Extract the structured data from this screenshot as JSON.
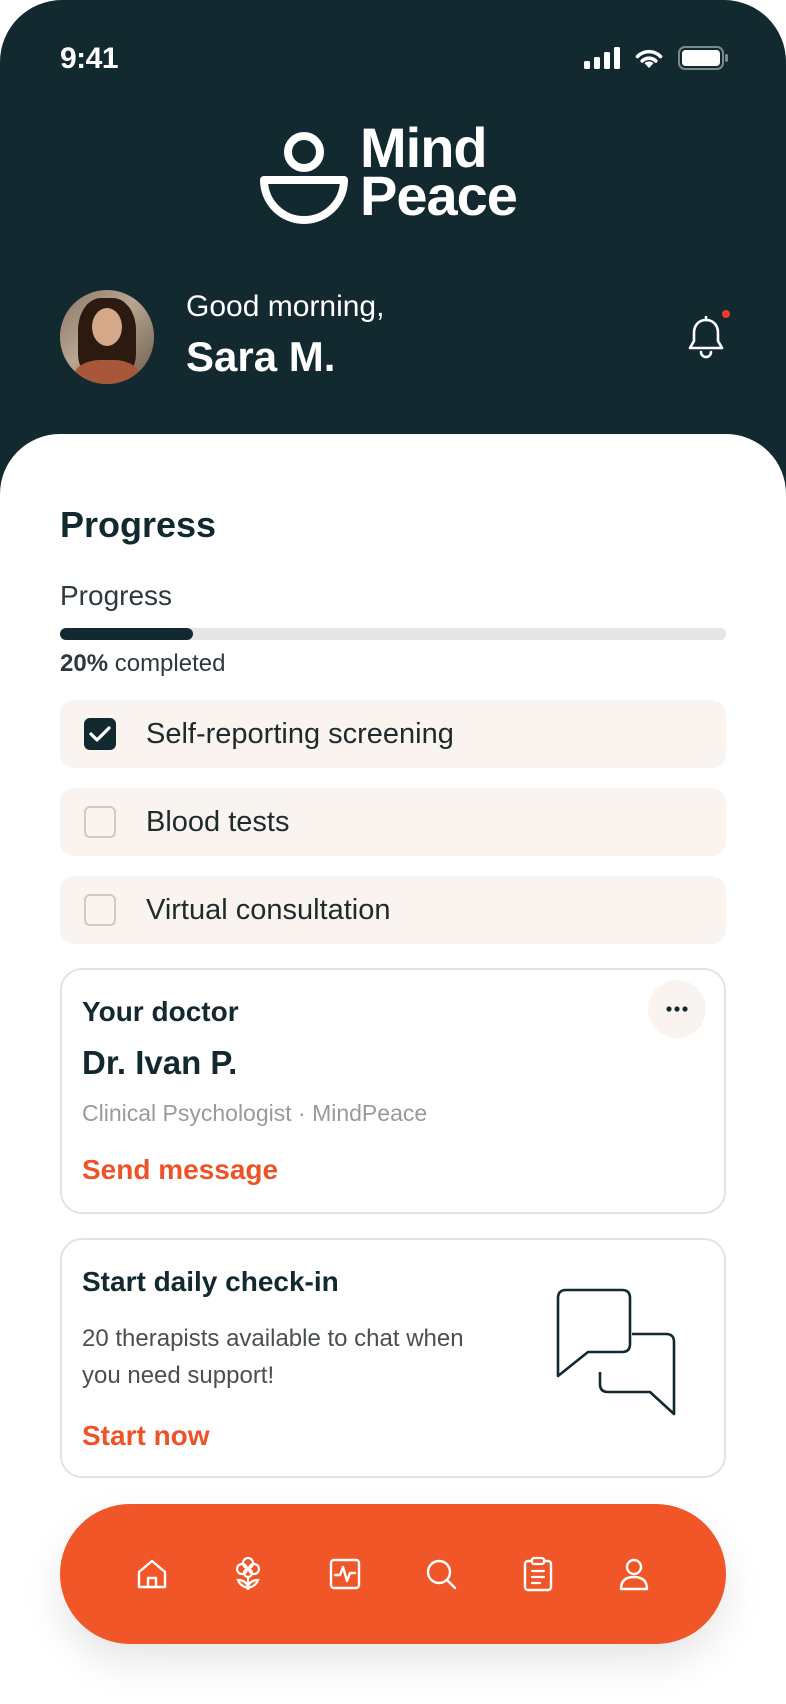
{
  "status_bar": {
    "time": "9:41",
    "icons": [
      "cellular-signal-icon",
      "wifi-icon",
      "battery-icon"
    ]
  },
  "brand": {
    "line1": "Mind",
    "line2": "Peace",
    "logo_icon": "person-bowl-logo-icon"
  },
  "greeting": {
    "hello": "Good morning,",
    "name": "Sara M."
  },
  "notifications": {
    "icon": "bell-icon",
    "has_unread": true
  },
  "progress": {
    "title": "Progress",
    "label": "Progress",
    "percent": 20,
    "percent_text": "20%",
    "completed_text": "completed",
    "tasks": [
      {
        "label": "Self-reporting screening",
        "checked": true
      },
      {
        "label": "Blood tests",
        "checked": false
      },
      {
        "label": "Virtual consultation",
        "checked": false
      }
    ]
  },
  "doctor_card": {
    "title": "Your doctor",
    "name": "Dr. Ivan P.",
    "role": "Clinical Psychologist · MindPeace",
    "action": "Send message",
    "more_icon": "ellipsis-icon"
  },
  "checkin_card": {
    "title": "Start daily check-in",
    "description": "20 therapists available to chat when you need support!",
    "action": "Start now",
    "illustration": "chat-bubbles-icon"
  },
  "bottom_nav": {
    "items": [
      "home-icon",
      "flower-icon",
      "health-activity-icon",
      "search-icon",
      "clipboard-icon",
      "profile-icon"
    ]
  },
  "colors": {
    "header_bg": "#11292f",
    "accent": "#f05628",
    "link": "#ee5328",
    "task_bg": "#f9f4ef",
    "notification_dot": "#ee3b2b"
  }
}
